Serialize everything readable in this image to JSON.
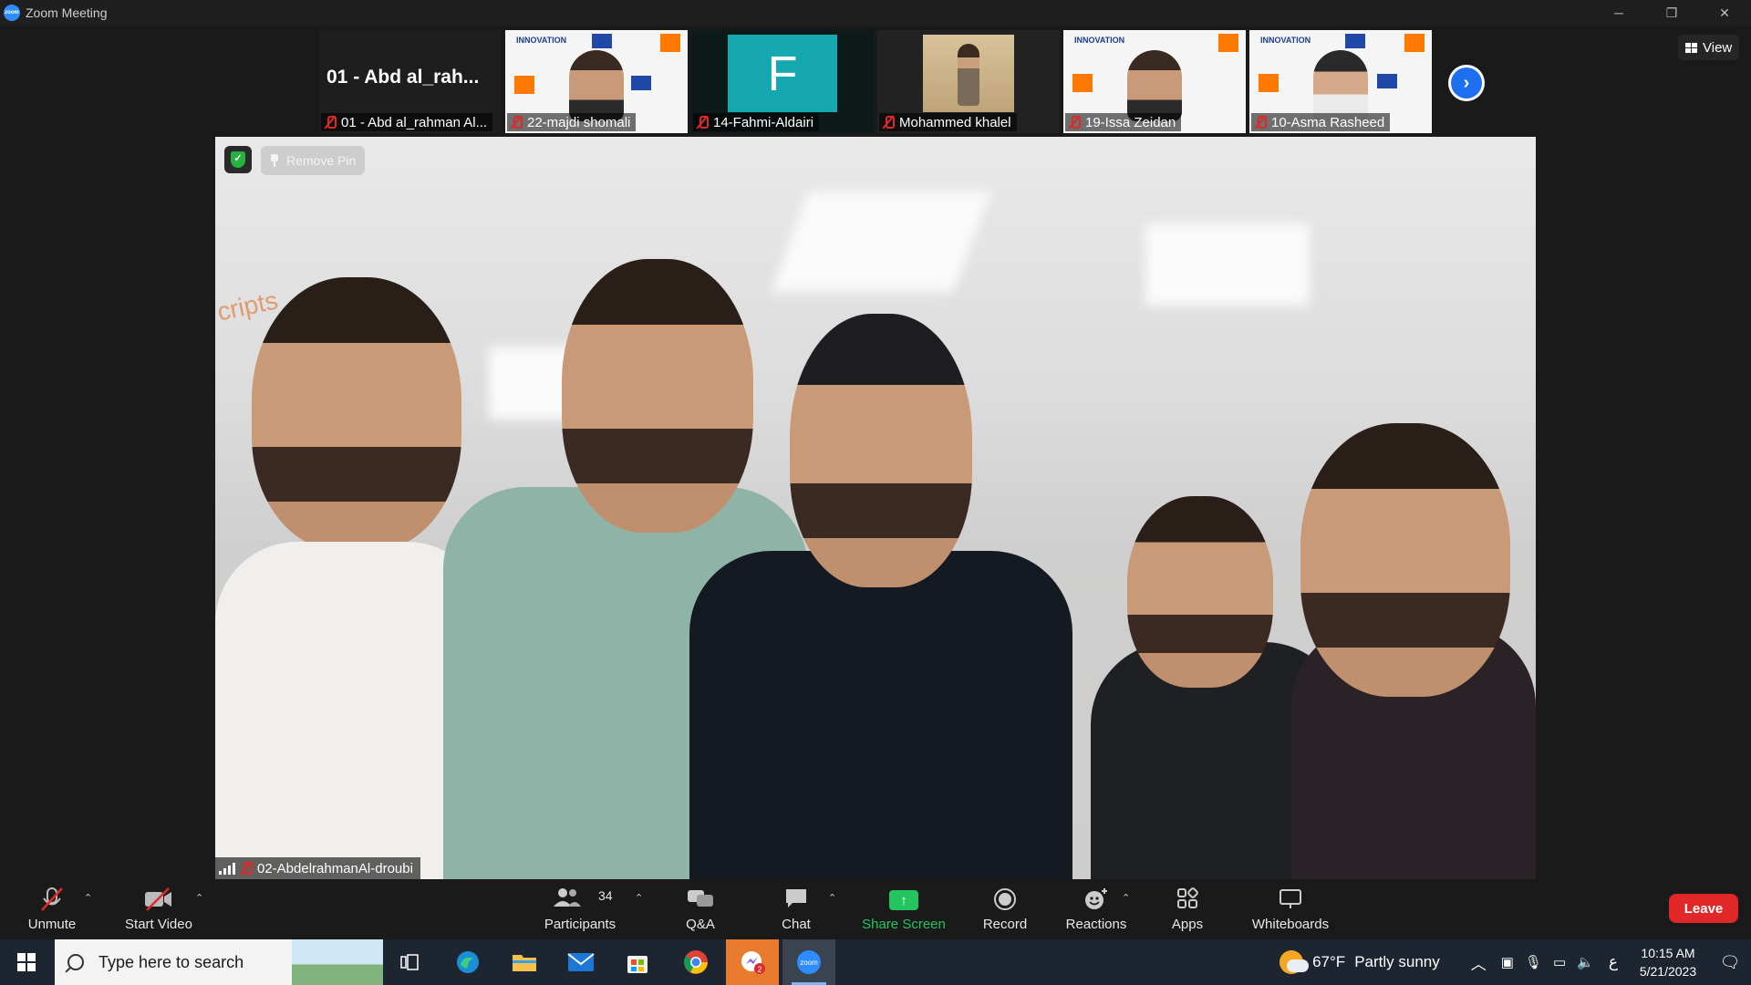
{
  "window": {
    "title": "Zoom Meeting",
    "app_icon_text": "zoom"
  },
  "gallery": {
    "tiles": [
      {
        "big_name": "01 - Abd al_rah...",
        "label": "01 - Abd al_rahman Al..."
      },
      {
        "label": "22-majdi shomali"
      },
      {
        "avatar_letter": "F",
        "label": "14-Fahmi-Aldairi"
      },
      {
        "label": "Mohammed khalel"
      },
      {
        "label": "19-Issa Zeidan"
      },
      {
        "label": "10-Asma Rasheed"
      }
    ],
    "next_icon": "chevron-right-icon",
    "view_label": "View"
  },
  "main_video": {
    "remove_pin_label": "Remove Pin",
    "speaker_label": "02-AbdelrahmanAl-droubi"
  },
  "toolbar": {
    "unmute_label": "Unmute",
    "start_video_label": "Start Video",
    "participants_label": "Participants",
    "participants_count": "34",
    "qa_label": "Q&A",
    "chat_label": "Chat",
    "share_screen_label": "Share Screen",
    "record_label": "Record",
    "reactions_label": "Reactions",
    "apps_label": "Apps",
    "whiteboards_label": "Whiteboards",
    "leave_label": "Leave"
  },
  "taskbar": {
    "search_placeholder": "Type here to search",
    "weather_temp": "67°F",
    "weather_text": "Partly sunny",
    "time": "10:15 AM",
    "date": "5/21/2023",
    "lang": "ع"
  },
  "colors": {
    "leave": "#e02828",
    "share": "#22c55e",
    "accent": "#1e6ff0"
  }
}
